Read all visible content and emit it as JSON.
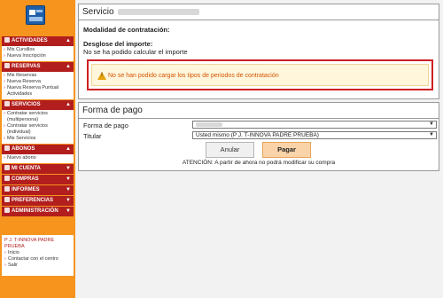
{
  "sidebar": {
    "sections": [
      {
        "title": "ACTIVIDADES",
        "items": [
          "Mis Cursillos",
          "Nueva Inscripción"
        ]
      },
      {
        "title": "RESERVAS",
        "items": [
          "Mis Reservas",
          "Nueva Reserva",
          "Nueva Reserva Puntual Actividades"
        ]
      },
      {
        "title": "SERVICIOS",
        "items": [
          "Contratar servicios (multipersona)",
          "Contratar servicios (individual)",
          "Mis Servicios"
        ]
      },
      {
        "title": "ABONOS",
        "items": [
          "Nuevo abono"
        ]
      },
      {
        "title": "MI CUENTA",
        "items": []
      },
      {
        "title": "COMPRAS",
        "items": []
      },
      {
        "title": "INFORMES",
        "items": []
      },
      {
        "title": "PREFERENCIAS",
        "items": []
      },
      {
        "title": "ADMINISTRACIÓN",
        "items": []
      }
    ],
    "user": {
      "name": "P J. T-INNOVA PADRE PRUEBA",
      "links": [
        "Inicio",
        "Contactar con el centro",
        "Salir"
      ]
    }
  },
  "service_panel": {
    "title": "Servicio",
    "mode_label": "Modalidad de contratación:",
    "breakdown_label": "Desglose del importe:",
    "breakdown_value": "No se ha podido calcular el importe",
    "warning": "No se han podido cargar los tipos de periodos de contratación"
  },
  "payment_panel": {
    "title": "Forma de pago",
    "method_label": "Forma de pago",
    "holder_label": "Titular",
    "holder_value": "Usted mismo (P J. T-INNOVA PADRE PRUEBA)",
    "cancel_label": "Anular",
    "pay_label": "Pagar",
    "notice": "ATENCIÓN: A partir de ahora no podrá modificar su compra"
  },
  "colors": {
    "sidebar_bg": "#f6941e",
    "section_head": "#b21e1e",
    "warning_border": "#d01f25",
    "warning_text": "#d35400",
    "pay_button": "#fbd3a8"
  }
}
